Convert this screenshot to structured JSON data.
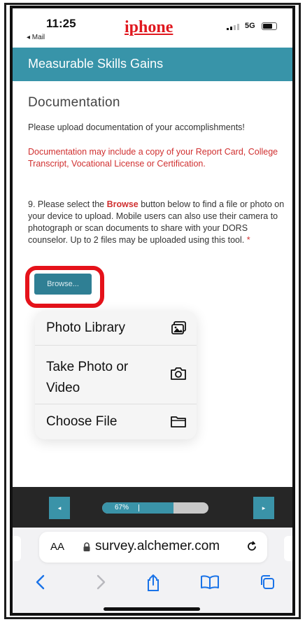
{
  "status_bar": {
    "time": "11:25",
    "back_label": "◂ Mail",
    "brand": "iphone",
    "network": "5G"
  },
  "header": {
    "title": "Measurable Skills Gains"
  },
  "section": {
    "title": "Documentation",
    "intro": "Please upload documentation of your accomplishments!",
    "note": "Documentation may include a copy of your Report Card, College Transcript, Vocational License or Certification.",
    "question_before": "9. Please select the ",
    "question_bold": "Browse",
    "question_after": " button below to find a file or photo on your device to upload. Mobile users can also use their camera to photograph or scan documents to share with your DORS counselor. Up to 2 files may be uploaded using this tool.",
    "required_mark": "*"
  },
  "browse_button": {
    "label": "Browse..."
  },
  "upload_menu": {
    "items": [
      {
        "label": "Photo Library",
        "icon": "photo-library-icon"
      },
      {
        "label": "Take Photo or Video",
        "icon": "camera-icon"
      },
      {
        "label": "Choose File",
        "icon": "folder-icon"
      }
    ]
  },
  "progress": {
    "value": 0.67,
    "label": "67%"
  },
  "navigation": {
    "prev": "◂",
    "next": "▸"
  },
  "browser": {
    "text_size_label": "AA",
    "url": "survey.alchemer.com"
  },
  "colors": {
    "header": "#3894a9",
    "brand": "#e0181f",
    "highlight_ring": "#e5121a",
    "note_text": "#d03030",
    "browser_icons": "#1a73e8"
  }
}
